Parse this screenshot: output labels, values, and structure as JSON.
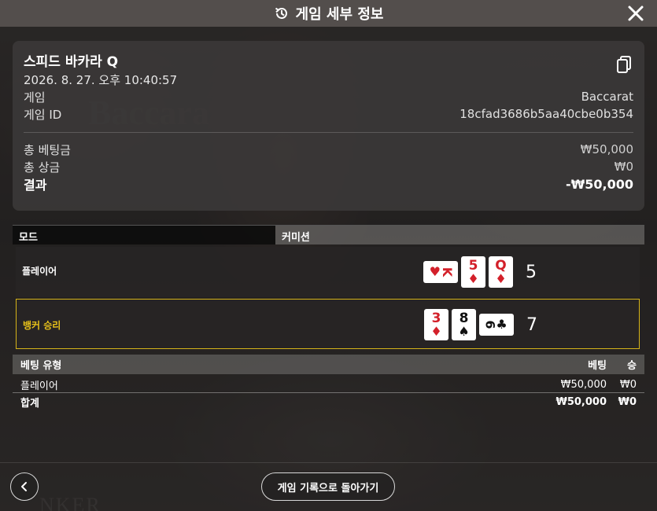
{
  "header": {
    "title": "게임 세부 정보"
  },
  "summary": {
    "game_name": "스피드 바카라 Q",
    "datetime": "2026. 8. 27. 오후 10:40:57",
    "rows": [
      {
        "label": "게임",
        "value": "Baccarat"
      },
      {
        "label": "게임 ID",
        "value": "18cfad3686b5aa40cbe0b354"
      }
    ],
    "totals": [
      {
        "label": "총 베팅금",
        "value": "₩50,000"
      },
      {
        "label": "총 상금",
        "value": "₩0"
      }
    ],
    "result": {
      "label": "결과",
      "value": "-₩50,000"
    }
  },
  "mode": {
    "label": "모드",
    "value": "커미션"
  },
  "hands": {
    "player": {
      "label": "플레이어",
      "score": "5",
      "cards": [
        {
          "rank": "K",
          "suit": "♥",
          "color": "red",
          "orientation": "landscape"
        },
        {
          "rank": "5",
          "suit": "♦",
          "color": "red",
          "orientation": "portrait"
        },
        {
          "rank": "Q",
          "suit": "♦",
          "color": "red",
          "orientation": "portrait"
        }
      ]
    },
    "banker": {
      "label": "뱅커 승리",
      "score": "7",
      "cards": [
        {
          "rank": "3",
          "suit": "♦",
          "color": "red",
          "orientation": "portrait"
        },
        {
          "rank": "8",
          "suit": "♠",
          "color": "black",
          "orientation": "portrait"
        },
        {
          "rank": "6",
          "suit": "♣",
          "color": "black",
          "orientation": "landscape"
        }
      ]
    }
  },
  "bets": {
    "headers": {
      "type": "베팅 유형",
      "bet": "베팅",
      "win": "승"
    },
    "rows": [
      {
        "type": "플레이어",
        "bet": "₩50,000",
        "win": "₩0"
      }
    ],
    "total": {
      "type": "합계",
      "bet": "₩50,000",
      "win": "₩0"
    }
  },
  "footer": {
    "history_button": "게임 기록으로 돌아가기"
  },
  "colors": {
    "banker_highlight": "#e8c21a",
    "card_red": "#d3202a"
  },
  "icons": {
    "header": "history-icon",
    "close": "close-icon",
    "copy": "copy-icon",
    "back": "chevron-left-icon"
  }
}
